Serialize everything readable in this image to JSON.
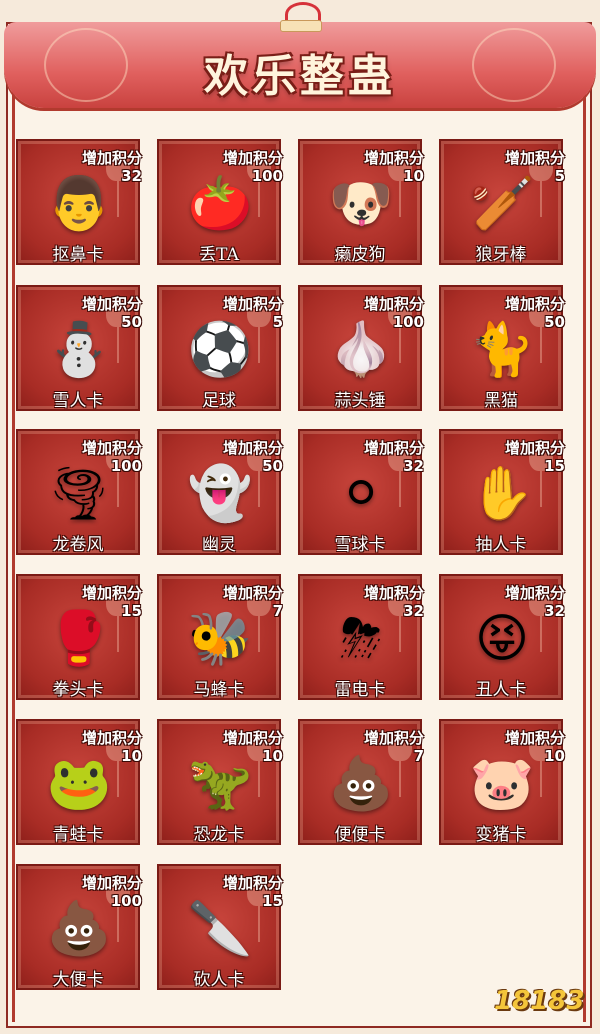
{
  "page": {
    "title": "欢乐整蛊",
    "watermark": "18183",
    "colors": {
      "card": "#a82c25",
      "banner": "#e0605e",
      "background": "#fbf3e8"
    }
  },
  "cards": [
    {
      "name": "抠鼻卡",
      "add_label": "增加积分",
      "points": "32",
      "icon": "nose-pick-man-icon",
      "glyph": "👨"
    },
    {
      "name": "丢TA",
      "add_label": "增加积分",
      "points": "100",
      "icon": "fruit-pile-icon",
      "glyph": "🍅"
    },
    {
      "name": "癞皮狗",
      "add_label": "增加积分",
      "points": "10",
      "icon": "bulldog-icon",
      "glyph": "🐶"
    },
    {
      "name": "狼牙棒",
      "add_label": "增加积分",
      "points": "5",
      "icon": "spiked-club-icon",
      "glyph": "🏏"
    },
    {
      "name": "雪人卡",
      "add_label": "增加积分",
      "points": "50",
      "icon": "snowman-icon",
      "glyph": "⛄"
    },
    {
      "name": "足球",
      "add_label": "增加积分",
      "points": "5",
      "icon": "soccer-ball-icon",
      "glyph": "⚽"
    },
    {
      "name": "蒜头锤",
      "add_label": "增加积分",
      "points": "100",
      "icon": "garlic-monster-icon",
      "glyph": "🧄"
    },
    {
      "name": "黑猫",
      "add_label": "增加积分",
      "points": "50",
      "icon": "black-cat-icon",
      "glyph": "🐈"
    },
    {
      "name": "龙卷风",
      "add_label": "增加积分",
      "points": "100",
      "icon": "tornado-icon",
      "glyph": "🌪"
    },
    {
      "name": "幽灵",
      "add_label": "增加积分",
      "points": "50",
      "icon": "ghost-icon",
      "glyph": "👻"
    },
    {
      "name": "雪球卡",
      "add_label": "增加积分",
      "points": "32",
      "icon": "snowball-icon",
      "glyph": "⚪"
    },
    {
      "name": "抽人卡",
      "add_label": "增加积分",
      "points": "15",
      "icon": "slapping-hand-icon",
      "glyph": "✋"
    },
    {
      "name": "拳头卡",
      "add_label": "增加积分",
      "points": "15",
      "icon": "boxing-glove-icon",
      "glyph": "🥊"
    },
    {
      "name": "马蜂卡",
      "add_label": "增加积分",
      "points": "7",
      "icon": "wasp-icon",
      "glyph": "🐝"
    },
    {
      "name": "雷电卡",
      "add_label": "增加积分",
      "points": "32",
      "icon": "thunder-cloud-icon",
      "glyph": "⛈"
    },
    {
      "name": "丑人卡",
      "add_label": "增加积分",
      "points": "32",
      "icon": "ugly-face-icon",
      "glyph": "😝"
    },
    {
      "name": "青蛙卡",
      "add_label": "增加积分",
      "points": "10",
      "icon": "frog-icon",
      "glyph": "🐸"
    },
    {
      "name": "恐龙卡",
      "add_label": "增加积分",
      "points": "10",
      "icon": "dinosaur-icon",
      "glyph": "🦖"
    },
    {
      "name": "便便卡",
      "add_label": "增加积分",
      "points": "7",
      "icon": "poop-icon",
      "glyph": "💩"
    },
    {
      "name": "变猪卡",
      "add_label": "增加积分",
      "points": "10",
      "icon": "pig-icon",
      "glyph": "🐷"
    },
    {
      "name": "大便卡",
      "add_label": "增加积分",
      "points": "100",
      "icon": "big-poop-icon",
      "glyph": "💩"
    },
    {
      "name": "砍人卡",
      "add_label": "增加积分",
      "points": "15",
      "icon": "cleaver-icon",
      "glyph": "🔪"
    }
  ]
}
